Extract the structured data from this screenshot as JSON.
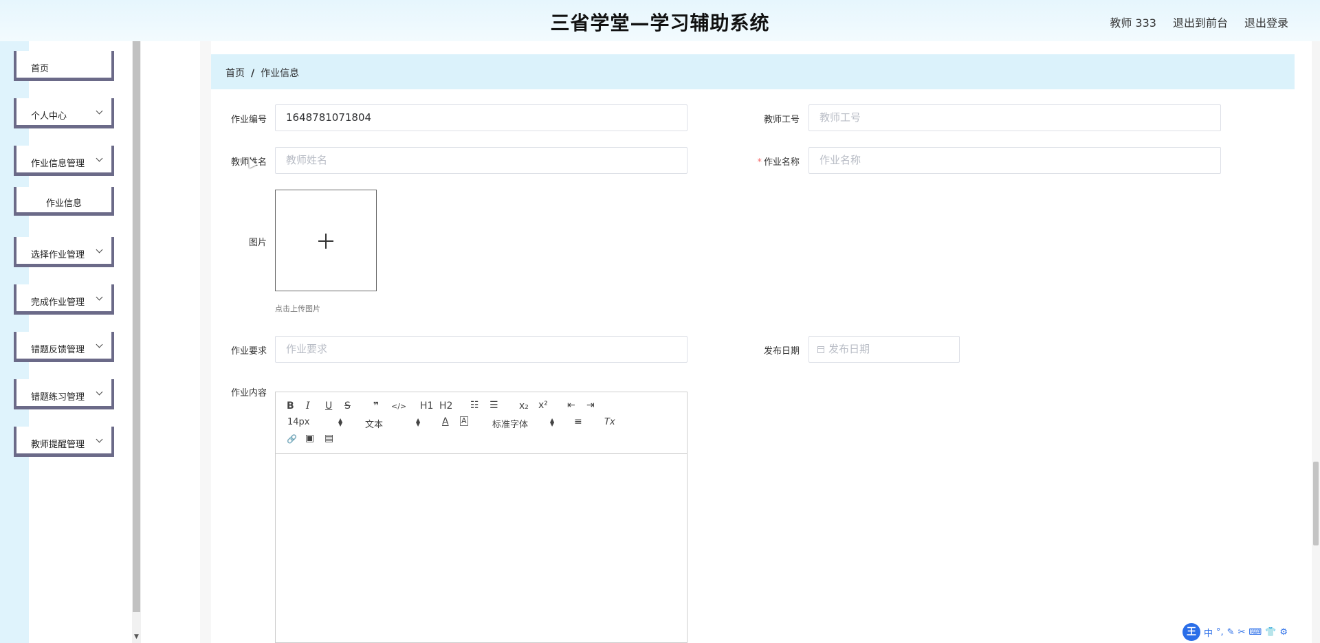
{
  "header": {
    "title": "三省学堂—学习辅助系统",
    "user": "教师 333",
    "to_front": "退出到前台",
    "logout": "退出登录"
  },
  "sidebar": {
    "items": [
      {
        "label": "首页"
      },
      {
        "label": "个人中心"
      },
      {
        "label": "作业信息管理"
      },
      {
        "label": "作业信息"
      },
      {
        "label": "选择作业管理"
      },
      {
        "label": "完成作业管理"
      },
      {
        "label": "错题反馈管理"
      },
      {
        "label": "错题练习管理"
      },
      {
        "label": "教师提醒管理"
      }
    ]
  },
  "breadcrumb": {
    "home": "首页",
    "separator": "/",
    "current": "作业信息"
  },
  "form": {
    "homework_no": {
      "label": "作业编号",
      "value": "1648781071804"
    },
    "teacher_no": {
      "label": "教师工号",
      "placeholder": "教师工号"
    },
    "teacher_name": {
      "label": "教师姓名",
      "placeholder": "教师姓名"
    },
    "homework_name": {
      "label": "作业名称",
      "required_mark": "*",
      "placeholder": "作业名称"
    },
    "image": {
      "label": "图片",
      "tip": "点击上传图片"
    },
    "requirement": {
      "label": "作业要求",
      "placeholder": "作业要求"
    },
    "publish_date": {
      "label": "发布日期",
      "placeholder": "发布日期"
    },
    "content": {
      "label": "作业内容"
    }
  },
  "editor_toolbar": {
    "bold": "B",
    "italic": "I",
    "underline": "U",
    "strike": "S",
    "quote": "❞",
    "code": "</>",
    "h1": "H1",
    "h2": "H2",
    "ordered_list": "☷",
    "bullet_list": "☰",
    "subscript": "x₂",
    "superscript": "x²",
    "outdent": "⇤",
    "indent": "⇥",
    "font_size": "14px",
    "header": "文本",
    "font_family": "标准字体",
    "font_color": "A",
    "bg_color": "A",
    "align": "≡",
    "clean": "Tx",
    "link": "🔗",
    "image": "▣",
    "video": "▤"
  },
  "ime": {
    "logo": "王",
    "mode": "中",
    "punct": "°,"
  }
}
